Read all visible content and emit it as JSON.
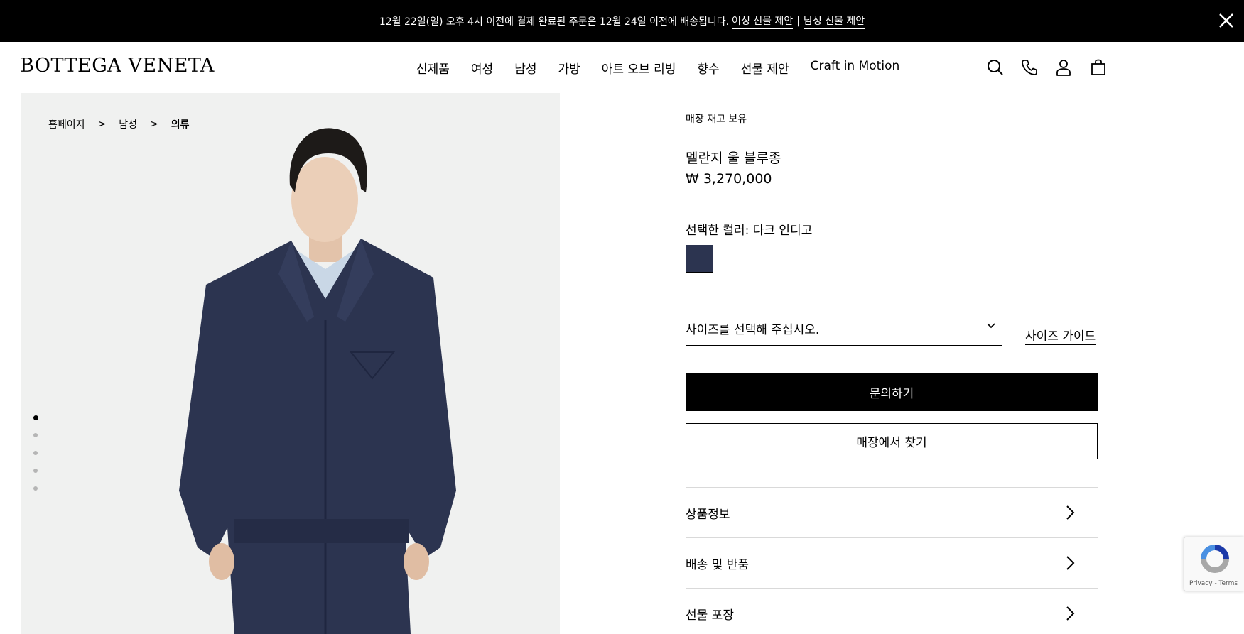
{
  "announcement": {
    "text": "12월 22일(일) 오후 4시 이전에 결제 완료된 주문은 12월 24일 이전에 배송됩니다.",
    "link_women": "여성 선물 제안",
    "separator": "|",
    "link_men": "남성 선물 제안",
    "close_icon": "close-icon"
  },
  "header": {
    "logo": "BOTTEGA VENETA",
    "nav": [
      "신제품",
      "여성",
      "남성",
      "가방",
      "아트 오브 리빙",
      "향수",
      "선물 제안",
      "Craft in Motion"
    ],
    "icons": [
      "search-icon",
      "phone-icon",
      "account-icon",
      "bag-icon"
    ]
  },
  "gallery": {
    "breadcrumb": [
      "홈페이지",
      "남성",
      "의류"
    ],
    "breadcrumb_separator": ">",
    "image_count": 5,
    "active_index": 0
  },
  "product": {
    "availability": "매장 재고 보유",
    "name": "멜란지 울 블루종",
    "price": "₩ 3,270,000",
    "color_label": "선택한 컬러: 다크 인디고",
    "swatch_color": "#2c3450",
    "size_placeholder": "사이즈를 선택해 주십시오.",
    "size_guide": "사이즈 가이드",
    "inquiry_button": "문의하기",
    "store_button": "매장에서 찾기",
    "accordion": [
      "상품정보",
      "배송 및 반품",
      "선물 포장"
    ]
  },
  "recaptcha": {
    "links": "Privacy - Terms"
  },
  "colors": {
    "banner_bg": "#000000",
    "gallery_bg": "#f0f1f0",
    "jacket": "#2c3450"
  }
}
